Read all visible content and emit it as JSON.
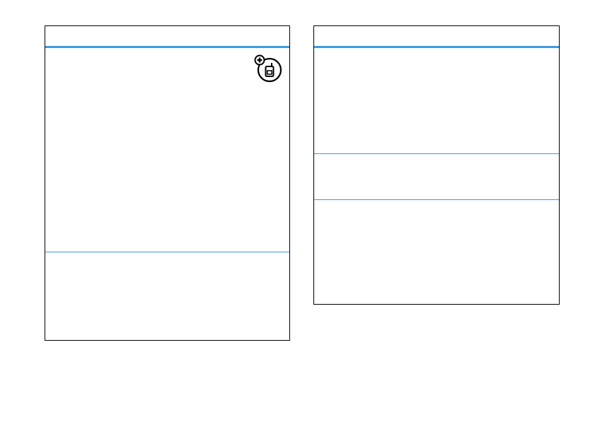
{
  "left_table": {
    "header": "",
    "rows": [
      {
        "text": "",
        "icon": "network-feature-icon"
      },
      {
        "text": ""
      }
    ]
  },
  "right_table": {
    "header": "",
    "rows": [
      {
        "text": ""
      },
      {
        "text": ""
      },
      {
        "text": ""
      }
    ]
  },
  "colors": {
    "rule": "#3d9be0",
    "border": "#000000",
    "background": "#ffffff"
  }
}
